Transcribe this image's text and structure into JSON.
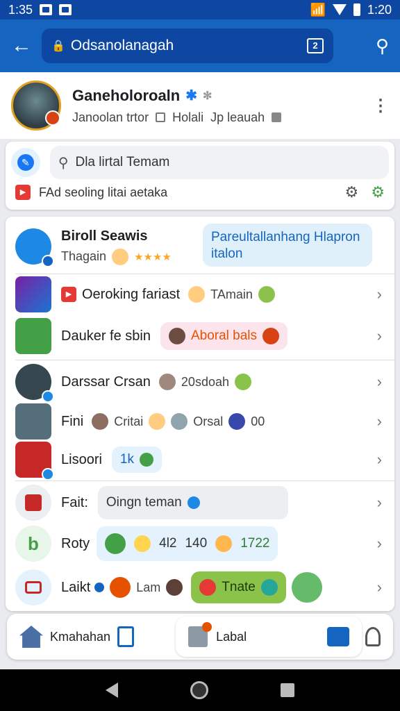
{
  "status": {
    "time": "1:35",
    "clock": "1:20"
  },
  "appbar": {
    "back_icon": "arrow-left-icon",
    "url": "Odsanolanagah",
    "tabs_count": "2",
    "search_icon": "search-icon"
  },
  "profile": {
    "name": "Ganeholoroaln",
    "sub_left": "Janoolan trtor",
    "sub_mid": "Holali",
    "sub_right": "Jp leauah",
    "colors": {
      "verified": "#1877f2",
      "avatar_ring": "#e0a020"
    }
  },
  "search": {
    "placeholder": "Dla lirtal Temam",
    "suggestion": "FAd seoling litai aetaka"
  },
  "list": [
    {
      "title": "Biroll Seawis",
      "meta": "Thagain",
      "stars": "★★★★",
      "bubble": "Pareultallanhang Hlapron italon",
      "bubble_color": "#dff0fb"
    },
    {
      "title": "Oeroking fariast",
      "meta": "TAmain"
    },
    {
      "title": "Dauker fe sbin",
      "bubble": "Aboral bals",
      "bubble_color": "#fce4ec"
    },
    {
      "title": "Darssar Crsan",
      "meta": "20sdoah"
    },
    {
      "title": "Fini",
      "meta": "Critai",
      "meta2": "Orsal",
      "meta3": "00"
    },
    {
      "title": "Lisoori",
      "bubble": "1k",
      "bubble_color": "#e3f2fd"
    },
    {
      "title": "Fait:",
      "bubble": "Oingn teman",
      "bubble_color": "#eceff1"
    },
    {
      "title": "Roty",
      "meta": "4l2",
      "meta2": "140",
      "meta3": "1722",
      "bubble_color": "#e3f2fd"
    },
    {
      "title": "Laikt",
      "meta": "Lam",
      "bubble": "Tnate",
      "bubble_color": "#8bc34a"
    }
  ],
  "bottom_nav": {
    "home": "Kmahahan",
    "tab": "Labal"
  }
}
